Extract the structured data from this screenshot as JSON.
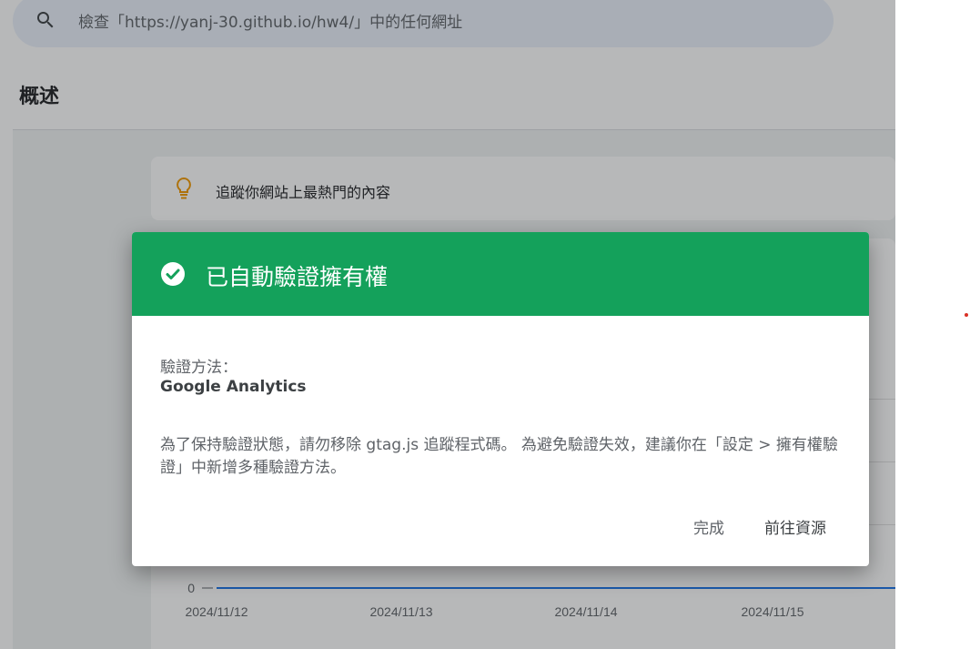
{
  "search": {
    "placeholder": "檢查「https://yanj-30.github.io/hw4/」中的任何網址",
    "icon": "search-icon"
  },
  "page": {
    "title": "概述"
  },
  "tip": {
    "icon": "lightbulb-icon",
    "text": "追蹤你網站上最熱門的內容"
  },
  "colors": {
    "dialog_header": "#14a15b",
    "bulb": "#f29900",
    "chart_line": "#1a73e8"
  },
  "dialog": {
    "icon": "check-circle-icon",
    "title": "已自動驗證擁有權",
    "method_label": "驗證方法：",
    "method_value": "Google Analytics",
    "description": "為了保持驗證狀態，請勿移除 gtag.js 追蹤程式碼。 為避免驗證失效，建議你在「設定 > 擁有權驗證」中新增多種驗證方法。",
    "done_label": "完成",
    "go_label": "前往資源"
  },
  "chart_data": {
    "type": "line",
    "x": [
      "2024/11/12",
      "2024/11/13",
      "2024/11/14",
      "2024/11/15"
    ],
    "series": [
      {
        "values": [
          0,
          0,
          0,
          0
        ]
      }
    ],
    "y_ticks": [
      "0"
    ]
  }
}
